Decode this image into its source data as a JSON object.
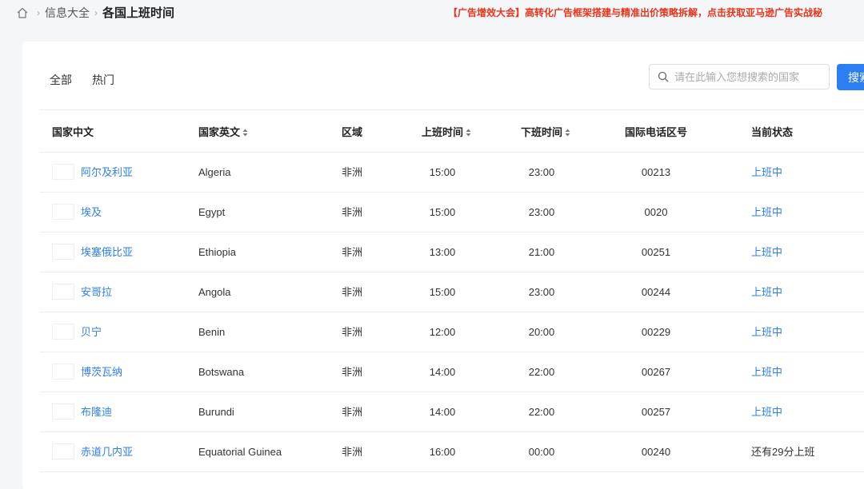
{
  "breadcrumb": {
    "items": [
      "信息大全",
      "各国上班时间"
    ]
  },
  "banner": "【广告增效大会】高转化广告框架搭建与精准出价策略拆解，点击获取亚马逊广告实战秘",
  "tabs": [
    "全部",
    "热门"
  ],
  "search": {
    "placeholder": "请在此输入您想搜索的国家",
    "value": "",
    "button_label": "搜索"
  },
  "table": {
    "headers": [
      "国家中文",
      "国家英文",
      "区域",
      "上班时间",
      "下班时间",
      "国际电话区号",
      "当前状态"
    ],
    "rows": [
      {
        "cn": "阿尔及利亚",
        "en": "Algeria",
        "region": "非洲",
        "start": "15:00",
        "end": "23:00",
        "code": "00213",
        "status": "上班中"
      },
      {
        "cn": "埃及",
        "en": "Egypt",
        "region": "非洲",
        "start": "15:00",
        "end": "23:00",
        "code": "0020",
        "status": "上班中"
      },
      {
        "cn": "埃塞俄比亚",
        "en": "Ethiopia",
        "region": "非洲",
        "start": "13:00",
        "end": "21:00",
        "code": "00251",
        "status": "上班中"
      },
      {
        "cn": "安哥拉",
        "en": "Angola",
        "region": "非洲",
        "start": "15:00",
        "end": "23:00",
        "code": "00244",
        "status": "上班中"
      },
      {
        "cn": "贝宁",
        "en": "Benin",
        "region": "非洲",
        "start": "12:00",
        "end": "20:00",
        "code": "00229",
        "status": "上班中"
      },
      {
        "cn": "博茨瓦纳",
        "en": "Botswana",
        "region": "非洲",
        "start": "14:00",
        "end": "22:00",
        "code": "00267",
        "status": "上班中"
      },
      {
        "cn": "布隆迪",
        "en": "Burundi",
        "region": "非洲",
        "start": "14:00",
        "end": "22:00",
        "code": "00257",
        "status": "上班中"
      },
      {
        "cn": "赤道几内亚",
        "en": "Equatorial Guinea",
        "region": "非洲",
        "start": "16:00",
        "end": "00:00",
        "code": "00240",
        "status": "还有29分上班"
      }
    ]
  },
  "colors": {
    "accent": "#2b7ef2",
    "link": "#2f7fe6",
    "banner": "#e8341c",
    "status_active": "#2f7fe6",
    "status_inactive": "#333333"
  }
}
